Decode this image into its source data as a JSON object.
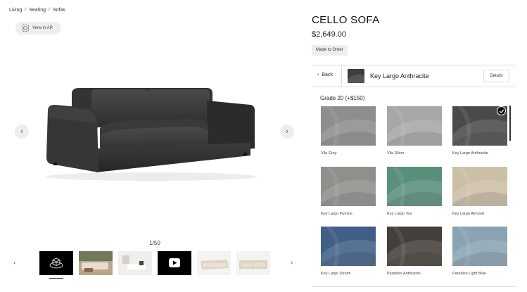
{
  "breadcrumb": [
    "Living",
    "Seating",
    "Sofas"
  ],
  "ar_button": {
    "label": "View in AR",
    "icon": "ar-cube-icon"
  },
  "gallery": {
    "counter": "1/50",
    "prev_icon": "chevron-left-icon",
    "next_icon": "chevron-right-icon",
    "thumbnails": [
      {
        "name": "thumb-ar-3d",
        "icon": "cube-3d-icon"
      },
      {
        "name": "thumb-lifestyle-1",
        "icon": ""
      },
      {
        "name": "thumb-lifestyle-2",
        "icon": ""
      },
      {
        "name": "thumb-video",
        "icon": "play-icon"
      },
      {
        "name": "thumb-sofa-cream-1",
        "icon": ""
      },
      {
        "name": "thumb-sofa-cream-2",
        "icon": ""
      }
    ]
  },
  "product": {
    "title": "CELLO SOFA",
    "price": "$2,649.00",
    "badge": "Made to Order"
  },
  "fabric_selector": {
    "back_label": "Back",
    "selected_name": "Key Largo Anthracite",
    "details_label": "Details"
  },
  "grade": {
    "label": "Grade 20 (+$150)"
  },
  "swatches": [
    {
      "label": "Vila Grey",
      "color": "#8e8e8e",
      "selected": false
    },
    {
      "label": "Vila Silver",
      "color": "#a7a7a7",
      "selected": false
    },
    {
      "label": "Key Largo Anthracite",
      "color": "#4a4a4c",
      "selected": true
    },
    {
      "label": "Key Largo Pumice",
      "color": "#8f8f8b",
      "selected": false
    },
    {
      "label": "Key Largo Tea",
      "color": "#5a8f7a",
      "selected": false
    },
    {
      "label": "Key Largo Almond",
      "color": "#cbbfa6",
      "selected": false
    },
    {
      "label": "Key Largo Denim",
      "color": "#3f5f86",
      "selected": false
    },
    {
      "label": "Paradiso Anthracite",
      "color": "#453f3b",
      "selected": false
    },
    {
      "label": "Paradiso Light Blue",
      "color": "#8aa3b3",
      "selected": false
    }
  ]
}
